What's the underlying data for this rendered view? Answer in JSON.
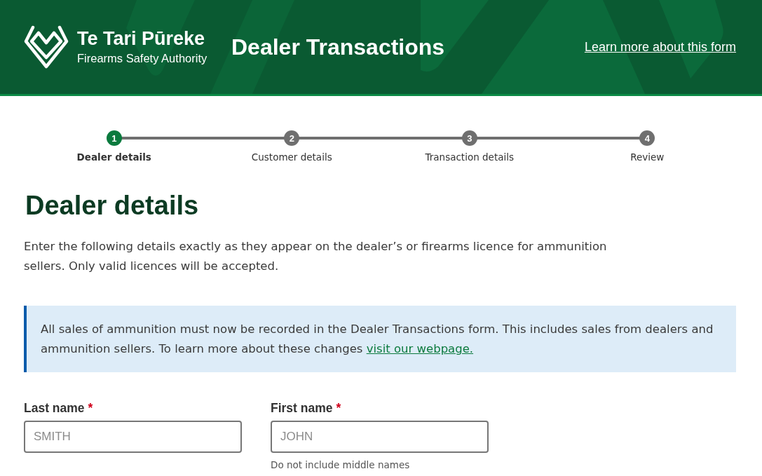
{
  "header": {
    "brand": {
      "name": "Te Tari Pūreke",
      "subtitle": "Firearms Safety Authority"
    },
    "title": "Dealer Transactions",
    "link": "Learn more about this form"
  },
  "stepper": {
    "steps": [
      {
        "number": "1",
        "label": "Dealer details",
        "selected": true
      },
      {
        "number": "2",
        "label": "Customer details",
        "selected": false
      },
      {
        "number": "3",
        "label": "Transaction details",
        "selected": false
      },
      {
        "number": "4",
        "label": "Review",
        "selected": false
      }
    ]
  },
  "heading": "Dealer details",
  "intro": "Enter the following details exactly as they appear on the dealer’s or firearms licence for ammunition sellers. Only valid licences will be accepted.",
  "notice": {
    "text": "All sales of ammunition must now be recorded in the Dealer Transactions form. This includes sales from dealers and ammunition sellers. To learn more about these changes",
    "link": "visit our webpage."
  },
  "fields": [
    {
      "label": "Last name",
      "required_mark": "*",
      "placeholder": "SMITH"
    },
    {
      "label": "First name",
      "required_mark": "*",
      "placeholder": "JOHN",
      "hint": "Do not include middle names"
    }
  ]
}
